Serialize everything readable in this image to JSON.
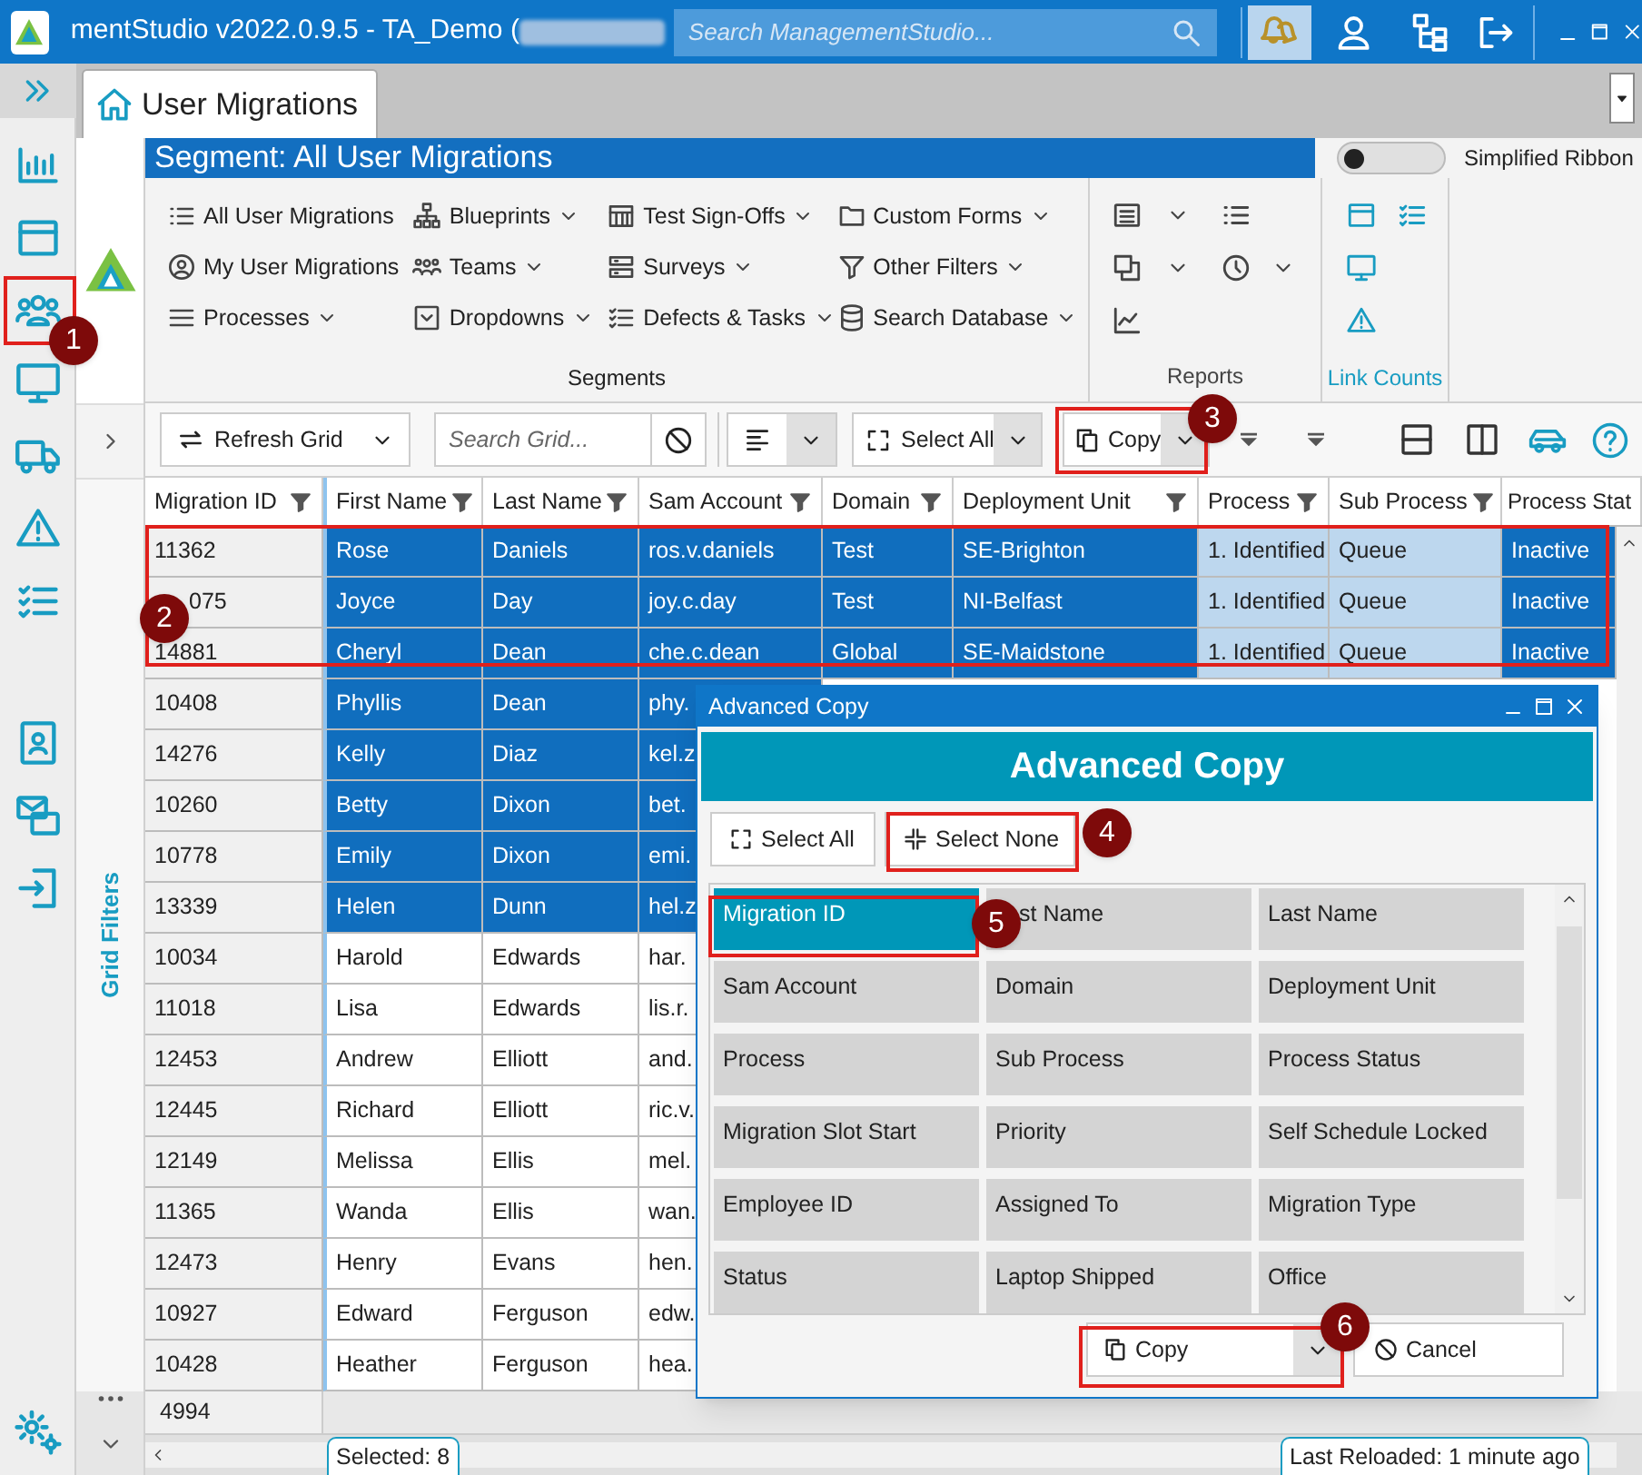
{
  "title_bar": {
    "title": "mentStudio v2022.0.9.5 - TA_Demo (",
    "search_placeholder": "Search ManagementStudio..."
  },
  "tab": {
    "label": "User Migrations"
  },
  "segment_title": "Segment: All User Migrations",
  "simplified_ribbon": {
    "label": "Simplified Ribbon",
    "on": false
  },
  "ribbon": {
    "segments": [
      {
        "label": "All User Migrations",
        "dropdown": false
      },
      {
        "label": "My User Migrations",
        "dropdown": false
      },
      {
        "label": "Processes",
        "dropdown": true
      },
      {
        "label": "Blueprints",
        "dropdown": true
      },
      {
        "label": "Teams",
        "dropdown": true
      },
      {
        "label": "Dropdowns",
        "dropdown": true
      },
      {
        "label": "Test Sign-Offs",
        "dropdown": true
      },
      {
        "label": "Surveys",
        "dropdown": true
      },
      {
        "label": "Defects & Tasks",
        "dropdown": true
      },
      {
        "label": "Custom Forms",
        "dropdown": true
      },
      {
        "label": "Other Filters",
        "dropdown": true
      },
      {
        "label": "Search Database",
        "dropdown": true
      }
    ],
    "groups": [
      "Segments",
      "Reports",
      "Link Counts"
    ]
  },
  "toolbar": {
    "refresh": "Refresh Grid",
    "search_placeholder": "Search Grid...",
    "select_all": "Select All",
    "copy": "Copy"
  },
  "grid_filters": "Grid Filters",
  "grid": {
    "columns": [
      "Migration ID",
      "First Name",
      "Last Name",
      "Sam Account",
      "Domain",
      "Deployment Unit",
      "Process",
      "Sub Process",
      "Process Stat"
    ],
    "rows": [
      {
        "selected": true,
        "cells": [
          "11362",
          "Rose",
          "Daniels",
          "ros.v.daniels",
          "Test",
          "SE-Brighton",
          "1. Identified",
          "Queue",
          "Inactive"
        ]
      },
      {
        "selected": true,
        "cells": [
          "075",
          "Joyce",
          "Day",
          "joy.c.day",
          "Test",
          "NI-Belfast",
          "1. Identified",
          "Queue",
          "Inactive"
        ]
      },
      {
        "selected": true,
        "cells": [
          "14881",
          "Cheryl",
          "Dean",
          "che.c.dean",
          "Global",
          "SE-Maidstone",
          "1. Identified",
          "Queue",
          "Inactive"
        ]
      },
      {
        "selected": true,
        "cells": [
          "10408",
          "Phyllis",
          "Dean",
          "phy."
        ]
      },
      {
        "selected": true,
        "cells": [
          "14276",
          "Kelly",
          "Diaz",
          "kel.z"
        ]
      },
      {
        "selected": true,
        "cells": [
          "10260",
          "Betty",
          "Dixon",
          "bet."
        ]
      },
      {
        "selected": true,
        "cells": [
          "10778",
          "Emily",
          "Dixon",
          "emi."
        ]
      },
      {
        "selected": true,
        "cells": [
          "13339",
          "Helen",
          "Dunn",
          "hel.z"
        ]
      },
      {
        "selected": false,
        "cells": [
          "10034",
          "Harold",
          "Edwards",
          "har."
        ]
      },
      {
        "selected": false,
        "cells": [
          "11018",
          "Lisa",
          "Edwards",
          "lis.r."
        ]
      },
      {
        "selected": false,
        "cells": [
          "12453",
          "Andrew",
          "Elliott",
          "and."
        ]
      },
      {
        "selected": false,
        "cells": [
          "12445",
          "Richard",
          "Elliott",
          "ric.v."
        ]
      },
      {
        "selected": false,
        "cells": [
          "12149",
          "Melissa",
          "Ellis",
          "mel."
        ]
      },
      {
        "selected": false,
        "cells": [
          "11365",
          "Wanda",
          "Ellis",
          "wan."
        ]
      },
      {
        "selected": false,
        "cells": [
          "12473",
          "Henry",
          "Evans",
          "hen."
        ]
      },
      {
        "selected": false,
        "cells": [
          "10927",
          "Edward",
          "Ferguson",
          "edw."
        ]
      },
      {
        "selected": false,
        "cells": [
          "10428",
          "Heather",
          "Ferguson",
          "hea."
        ]
      }
    ],
    "total": "4994"
  },
  "status_bar": {
    "selected": "Selected: 8",
    "last_reloaded": "Last Reloaded: 1 minute ago"
  },
  "dialog": {
    "title": "Advanced Copy",
    "heading": "Advanced Copy",
    "select_all": "Select All",
    "select_none": "Select None",
    "fields": [
      {
        "label": "Migration ID",
        "selected": true
      },
      {
        "label": "st Name",
        "selected": false
      },
      {
        "label": "Last Name",
        "selected": false
      },
      {
        "label": "Sam Account",
        "selected": false
      },
      {
        "label": "Domain",
        "selected": false
      },
      {
        "label": "Deployment Unit",
        "selected": false
      },
      {
        "label": "Process",
        "selected": false
      },
      {
        "label": "Sub Process",
        "selected": false
      },
      {
        "label": "Process Status",
        "selected": false
      },
      {
        "label": "Migration Slot Start",
        "selected": false
      },
      {
        "label": "Priority",
        "selected": false
      },
      {
        "label": "Self Schedule Locked",
        "selected": false
      },
      {
        "label": "Employee ID",
        "selected": false
      },
      {
        "label": "Assigned To",
        "selected": false
      },
      {
        "label": "Migration Type",
        "selected": false
      },
      {
        "label": "Status",
        "selected": false
      },
      {
        "label": "Laptop Shipped",
        "selected": false
      },
      {
        "label": "Office",
        "selected": false
      }
    ],
    "copy": "Copy",
    "cancel": "Cancel"
  },
  "annotations": [
    "1",
    "2",
    "3",
    "4",
    "5",
    "6"
  ]
}
